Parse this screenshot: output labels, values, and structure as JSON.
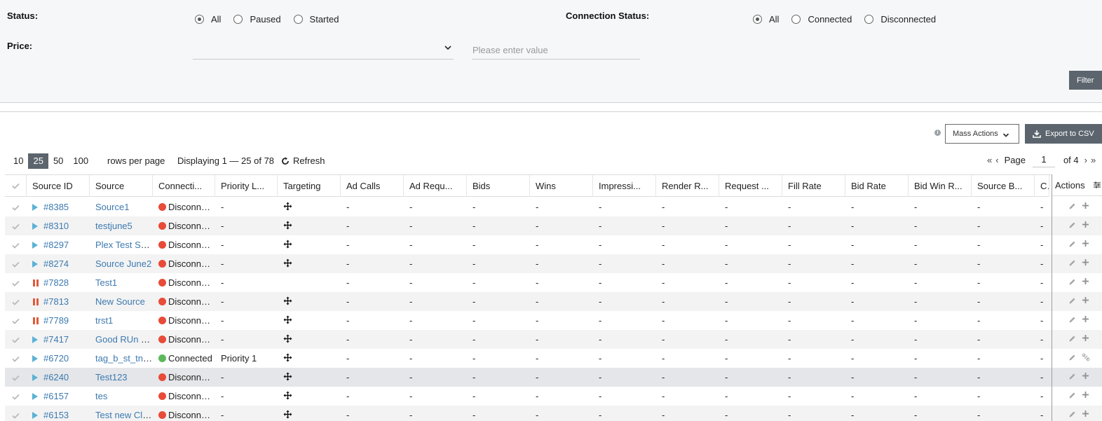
{
  "filters": {
    "status_label": "Status:",
    "status_options": [
      "All",
      "Paused",
      "Started"
    ],
    "status_selected": "All",
    "connection_label": "Connection Status:",
    "connection_options": [
      "All",
      "Connected",
      "Disconnected"
    ],
    "connection_selected": "All",
    "price_label": "Price:",
    "price_select_value": "",
    "price_value_placeholder": "Please enter value",
    "filter_button": "Filter"
  },
  "toolbar": {
    "info_icon": "info-icon",
    "mass_actions_label": "Mass Actions",
    "export_label": "Export to CSV"
  },
  "paging": {
    "rows_options": [
      "10",
      "25",
      "50",
      "100"
    ],
    "rows_selected": "25",
    "rows_label": "rows per page",
    "displaying": "Displaying 1 — 25 of 78",
    "refresh_label": "Refresh",
    "page_label": "Page",
    "page_value": "1",
    "of_label": "of 4"
  },
  "table": {
    "columns": [
      "Source ID",
      "Source",
      "Connecti...",
      "Priority L...",
      "Targeting",
      "Ad Calls",
      "Ad Requ...",
      "Bids",
      "Wins",
      "Impressi...",
      "Render R...",
      "Request ...",
      "Fill Rate",
      "Bid Rate",
      "Bid Win R...",
      "Source B...",
      "Cha"
    ],
    "actions_header": "Actions",
    "rows": [
      {
        "status": "started",
        "id": "#8385",
        "source": "Source1",
        "connection": "Disconnected",
        "priority": "-",
        "targeting": true,
        "metrics": [
          "-",
          "-",
          "-",
          "-",
          "-",
          "-",
          "-",
          "-",
          "-",
          "-",
          "-",
          "-"
        ]
      },
      {
        "status": "started",
        "id": "#8310",
        "source": "testjune5",
        "connection": "Disconnected",
        "priority": "-",
        "targeting": true,
        "metrics": [
          "-",
          "-",
          "-",
          "-",
          "-",
          "-",
          "-",
          "-",
          "-",
          "-",
          "-",
          "-"
        ]
      },
      {
        "status": "started",
        "id": "#8297",
        "source": "Plex Test Source",
        "connection": "Disconnected",
        "priority": "-",
        "targeting": true,
        "metrics": [
          "-",
          "-",
          "-",
          "-",
          "-",
          "-",
          "-",
          "-",
          "-",
          "-",
          "-",
          "-"
        ]
      },
      {
        "status": "started",
        "id": "#8274",
        "source": "Source June2",
        "connection": "Disconnected",
        "priority": "-",
        "targeting": true,
        "metrics": [
          "-",
          "-",
          "-",
          "-",
          "-",
          "-",
          "-",
          "-",
          "-",
          "-",
          "-",
          "-"
        ]
      },
      {
        "status": "paused",
        "id": "#7828",
        "source": "Test1",
        "connection": "Disconnected",
        "priority": "-",
        "targeting": false,
        "metrics": [
          "-",
          "-",
          "-",
          "-",
          "-",
          "-",
          "-",
          "-",
          "-",
          "-",
          "-",
          "-"
        ]
      },
      {
        "status": "paused",
        "id": "#7813",
        "source": "New Source",
        "connection": "Disconnected",
        "priority": "-",
        "targeting": true,
        "metrics": [
          "-",
          "-",
          "-",
          "-",
          "-",
          "-",
          "-",
          "-",
          "-",
          "-",
          "-",
          "-"
        ]
      },
      {
        "status": "paused",
        "id": "#7789",
        "source": "trst1",
        "connection": "Disconnected",
        "priority": "-",
        "targeting": true,
        "metrics": [
          "-",
          "-",
          "-",
          "-",
          "-",
          "-",
          "-",
          "-",
          "-",
          "-",
          "-",
          "-"
        ]
      },
      {
        "status": "started",
        "id": "#7417",
        "source": "Good RUn Source",
        "connection": "Disconnected",
        "priority": "-",
        "targeting": true,
        "metrics": [
          "-",
          "-",
          "-",
          "-",
          "-",
          "-",
          "-",
          "-",
          "-",
          "-",
          "-",
          "-"
        ]
      },
      {
        "status": "started",
        "id": "#6720",
        "source": "tag_b_st_tn_source",
        "connection": "Connected",
        "priority": "Priority 1",
        "targeting": true,
        "metrics": [
          "-",
          "-",
          "-",
          "-",
          "-",
          "-",
          "-",
          "-",
          "-",
          "-",
          "-",
          "-"
        ]
      },
      {
        "status": "started",
        "id": "#6240",
        "source": "Test123",
        "connection": "Disconnected",
        "priority": "-",
        "targeting": true,
        "metrics": [
          "-",
          "-",
          "-",
          "-",
          "-",
          "-",
          "-",
          "-",
          "-",
          "-",
          "-",
          "-"
        ]
      },
      {
        "status": "started",
        "id": "#6157",
        "source": "tes",
        "connection": "Disconnected",
        "priority": "-",
        "targeting": true,
        "metrics": [
          "-",
          "-",
          "-",
          "-",
          "-",
          "-",
          "-",
          "-",
          "-",
          "-",
          "-",
          "-"
        ]
      },
      {
        "status": "started",
        "id": "#6153",
        "source": "Test new Client",
        "connection": "Disconnected",
        "priority": "-",
        "targeting": true,
        "metrics": [
          "-",
          "-",
          "-",
          "-",
          "-",
          "-",
          "-",
          "-",
          "-",
          "-",
          "-",
          "-"
        ]
      }
    ],
    "row_actions": [
      "edit-icon",
      "add-icon"
    ],
    "connected_row_actions": [
      "edit-icon",
      "unlink-icon"
    ]
  },
  "colors": {
    "accent_dark": "#5c656d",
    "link": "#3d7ab0",
    "disconnected": "#e84b38",
    "connected": "#5cb85c",
    "started": "#5bb2d6",
    "paused": "#e05a3a"
  }
}
